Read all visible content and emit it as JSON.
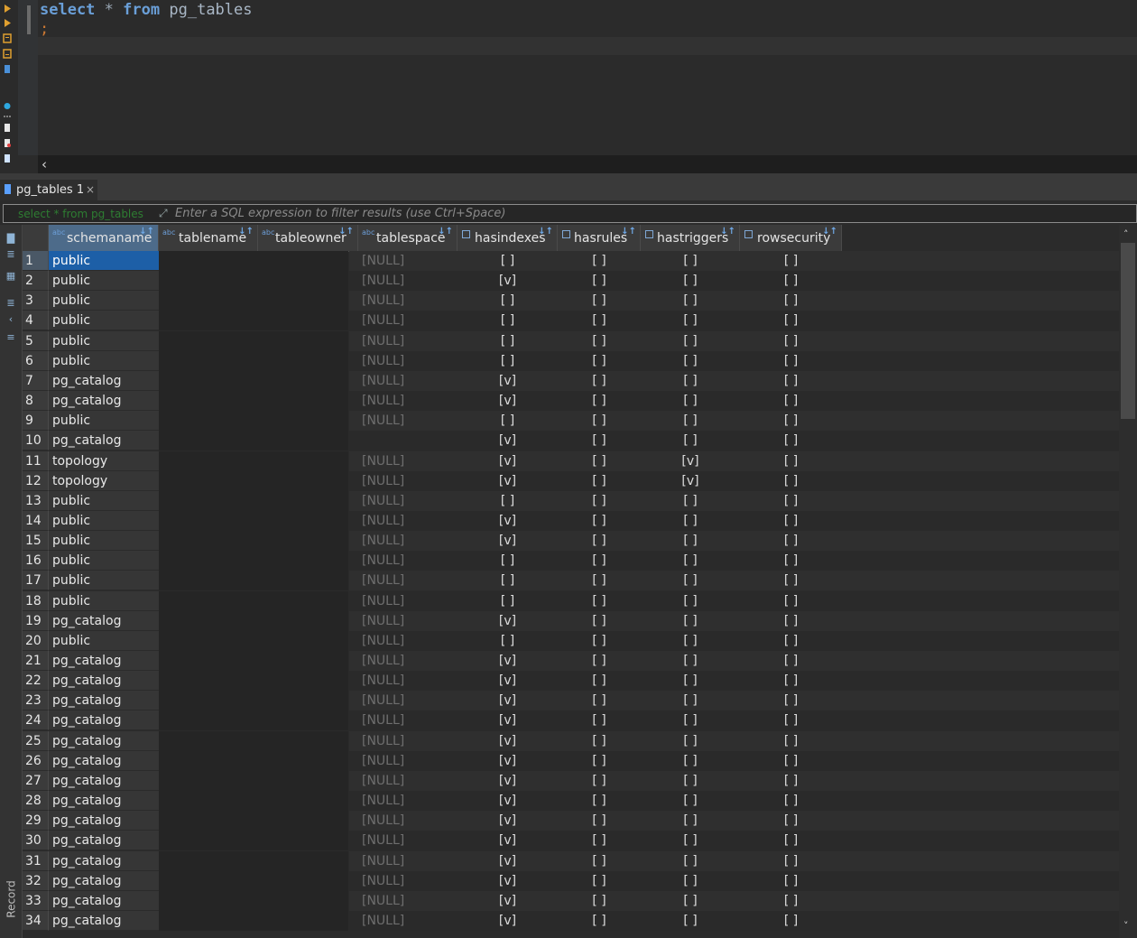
{
  "editor": {
    "sql_keyword_select": "select",
    "sql_star": "*",
    "sql_keyword_from": "from",
    "sql_table": "pg_tables",
    "sql_terminator": ";"
  },
  "results_tab": {
    "label": "pg_tables 1",
    "close": "×"
  },
  "filter": {
    "query_label": "select * from pg_tables",
    "placeholder": "Enter a SQL expression to filter results (use Ctrl+Space)"
  },
  "side_panel": {
    "record_label": "Record"
  },
  "grid": {
    "columns": [
      "schemaname",
      "tablename",
      "tableowner",
      "tablespace",
      "hasindexes",
      "hasrules",
      "hastriggers",
      "rowsecurity"
    ],
    "rows": [
      {
        "n": "1",
        "schema": "public",
        "space": "[NULL]",
        "idx": "[ ]",
        "rules": "[ ]",
        "trig": "[ ]",
        "sec": "[ ]"
      },
      {
        "n": "2",
        "schema": "public",
        "space": "[NULL]",
        "idx": "[v]",
        "rules": "[ ]",
        "trig": "[ ]",
        "sec": "[ ]"
      },
      {
        "n": "3",
        "schema": "public",
        "space": "[NULL]",
        "idx": "[ ]",
        "rules": "[ ]",
        "trig": "[ ]",
        "sec": "[ ]"
      },
      {
        "n": "4",
        "schema": "public",
        "space": "[NULL]",
        "idx": "[ ]",
        "rules": "[ ]",
        "trig": "[ ]",
        "sec": "[ ]"
      },
      {
        "n": "5",
        "schema": "public",
        "space": "[NULL]",
        "idx": "[ ]",
        "rules": "[ ]",
        "trig": "[ ]",
        "sec": "[ ]"
      },
      {
        "n": "6",
        "schema": "public",
        "space": "[NULL]",
        "idx": "[ ]",
        "rules": "[ ]",
        "trig": "[ ]",
        "sec": "[ ]"
      },
      {
        "n": "7",
        "schema": "pg_catalog",
        "space": "[NULL]",
        "idx": "[v]",
        "rules": "[ ]",
        "trig": "[ ]",
        "sec": "[ ]"
      },
      {
        "n": "8",
        "schema": "pg_catalog",
        "space": "[NULL]",
        "idx": "[v]",
        "rules": "[ ]",
        "trig": "[ ]",
        "sec": "[ ]"
      },
      {
        "n": "9",
        "schema": "public",
        "space": "[NULL]",
        "idx": "[ ]",
        "rules": "[ ]",
        "trig": "[ ]",
        "sec": "[ ]"
      },
      {
        "n": "10",
        "schema": "pg_catalog",
        "space": "",
        "idx": "[v]",
        "rules": "[ ]",
        "trig": "[ ]",
        "sec": "[ ]"
      },
      {
        "n": "11",
        "schema": "topology",
        "space": "[NULL]",
        "idx": "[v]",
        "rules": "[ ]",
        "trig": "[v]",
        "sec": "[ ]"
      },
      {
        "n": "12",
        "schema": "topology",
        "space": "[NULL]",
        "idx": "[v]",
        "rules": "[ ]",
        "trig": "[v]",
        "sec": "[ ]"
      },
      {
        "n": "13",
        "schema": "public",
        "space": "[NULL]",
        "idx": "[ ]",
        "rules": "[ ]",
        "trig": "[ ]",
        "sec": "[ ]"
      },
      {
        "n": "14",
        "schema": "public",
        "space": "[NULL]",
        "idx": "[v]",
        "rules": "[ ]",
        "trig": "[ ]",
        "sec": "[ ]"
      },
      {
        "n": "15",
        "schema": "public",
        "space": "[NULL]",
        "idx": "[v]",
        "rules": "[ ]",
        "trig": "[ ]",
        "sec": "[ ]"
      },
      {
        "n": "16",
        "schema": "public",
        "space": "[NULL]",
        "idx": "[ ]",
        "rules": "[ ]",
        "trig": "[ ]",
        "sec": "[ ]"
      },
      {
        "n": "17",
        "schema": "public",
        "space": "[NULL]",
        "idx": "[ ]",
        "rules": "[ ]",
        "trig": "[ ]",
        "sec": "[ ]"
      },
      {
        "n": "18",
        "schema": "public",
        "space": "[NULL]",
        "idx": "[ ]",
        "rules": "[ ]",
        "trig": "[ ]",
        "sec": "[ ]"
      },
      {
        "n": "19",
        "schema": "pg_catalog",
        "space": "[NULL]",
        "idx": "[v]",
        "rules": "[ ]",
        "trig": "[ ]",
        "sec": "[ ]"
      },
      {
        "n": "20",
        "schema": "public",
        "space": "[NULL]",
        "idx": "[ ]",
        "rules": "[ ]",
        "trig": "[ ]",
        "sec": "[ ]"
      },
      {
        "n": "21",
        "schema": "pg_catalog",
        "space": "[NULL]",
        "idx": "[v]",
        "rules": "[ ]",
        "trig": "[ ]",
        "sec": "[ ]"
      },
      {
        "n": "22",
        "schema": "pg_catalog",
        "space": "[NULL]",
        "idx": "[v]",
        "rules": "[ ]",
        "trig": "[ ]",
        "sec": "[ ]"
      },
      {
        "n": "23",
        "schema": "pg_catalog",
        "space": "[NULL]",
        "idx": "[v]",
        "rules": "[ ]",
        "trig": "[ ]",
        "sec": "[ ]"
      },
      {
        "n": "24",
        "schema": "pg_catalog",
        "space": "[NULL]",
        "idx": "[v]",
        "rules": "[ ]",
        "trig": "[ ]",
        "sec": "[ ]"
      },
      {
        "n": "25",
        "schema": "pg_catalog",
        "space": "[NULL]",
        "idx": "[v]",
        "rules": "[ ]",
        "trig": "[ ]",
        "sec": "[ ]"
      },
      {
        "n": "26",
        "schema": "pg_catalog",
        "space": "[NULL]",
        "idx": "[v]",
        "rules": "[ ]",
        "trig": "[ ]",
        "sec": "[ ]"
      },
      {
        "n": "27",
        "schema": "pg_catalog",
        "space": "[NULL]",
        "idx": "[v]",
        "rules": "[ ]",
        "trig": "[ ]",
        "sec": "[ ]"
      },
      {
        "n": "28",
        "schema": "pg_catalog",
        "space": "[NULL]",
        "idx": "[v]",
        "rules": "[ ]",
        "trig": "[ ]",
        "sec": "[ ]"
      },
      {
        "n": "29",
        "schema": "pg_catalog",
        "space": "[NULL]",
        "idx": "[v]",
        "rules": "[ ]",
        "trig": "[ ]",
        "sec": "[ ]"
      },
      {
        "n": "30",
        "schema": "pg_catalog",
        "space": "[NULL]",
        "idx": "[v]",
        "rules": "[ ]",
        "trig": "[ ]",
        "sec": "[ ]"
      },
      {
        "n": "31",
        "schema": "pg_catalog",
        "space": "[NULL]",
        "idx": "[v]",
        "rules": "[ ]",
        "trig": "[ ]",
        "sec": "[ ]"
      },
      {
        "n": "32",
        "schema": "pg_catalog",
        "space": "[NULL]",
        "idx": "[v]",
        "rules": "[ ]",
        "trig": "[ ]",
        "sec": "[ ]"
      },
      {
        "n": "33",
        "schema": "pg_catalog",
        "space": "[NULL]",
        "idx": "[v]",
        "rules": "[ ]",
        "trig": "[ ]",
        "sec": "[ ]"
      },
      {
        "n": "34",
        "schema": "pg_catalog",
        "space": "[NULL]",
        "idx": "[v]",
        "rules": "[ ]",
        "trig": "[ ]",
        "sec": "[ ]"
      }
    ]
  },
  "colors": {
    "background": "#2b2b2b",
    "selection": "#1d5fa7",
    "keyword": "#6a9fd8",
    "null_text": "#6e6e6e"
  }
}
